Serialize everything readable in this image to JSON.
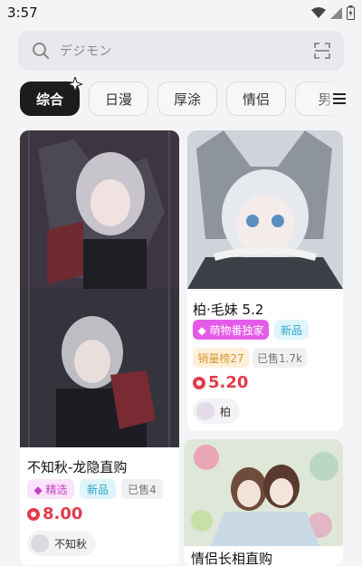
{
  "status_bar": {
    "time": "3:57",
    "icons": [
      "wifi-icon",
      "signal-icon",
      "battery-icon"
    ]
  },
  "search": {
    "placeholder": "デジモン",
    "icon": "search-icon",
    "scan_icon": "scan-icon"
  },
  "tabs": [
    {
      "label": "综合",
      "active": true
    },
    {
      "label": "日漫",
      "active": false
    },
    {
      "label": "厚涂",
      "active": false
    },
    {
      "label": "情侣",
      "active": false
    },
    {
      "label": "男",
      "active": false
    }
  ],
  "menu_icon": "menu-icon",
  "cards": [
    {
      "title": "不知秋-龙隐直购",
      "tags": [
        {
          "text": "◆ 精选",
          "style": "pink"
        },
        {
          "text": "新品",
          "style": "cyan"
        },
        {
          "text": "已售4",
          "style": "gray"
        }
      ],
      "price": "8.00",
      "author": "不知秋"
    },
    {
      "title": "柏·毛妹 5.2",
      "tags": [
        {
          "text": "◆ 萌物番独家",
          "style": "pinksolid"
        },
        {
          "text": "新品",
          "style": "cyan"
        },
        {
          "text": "销量榜27",
          "style": "orange"
        },
        {
          "text": "已售1.7k",
          "style": "gray"
        }
      ],
      "price": "5.20",
      "author": "柏"
    },
    {
      "title": "情侣长相直购",
      "tags": [],
      "price": "",
      "author": ""
    }
  ],
  "colors": {
    "price": "#e23b4c",
    "tab_active_bg": "#1d1d1f",
    "page_bg": "#f4f4f6"
  }
}
